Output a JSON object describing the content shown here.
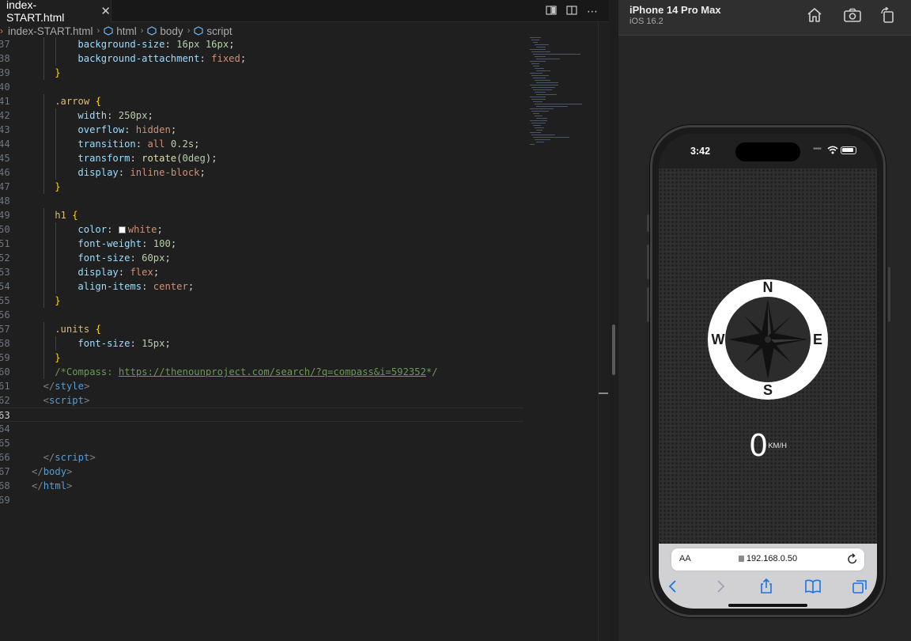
{
  "editor": {
    "tab_title": "index-START.html",
    "tab_close": "✕",
    "breadcrumb": {
      "file": "index-START.html",
      "html": "html",
      "body": "body",
      "script": "script"
    },
    "lines": [
      {
        "n": "37",
        "indent": 2,
        "t": [
          [
            "c-prop",
            "background-size"
          ],
          [
            "c-punc",
            ": "
          ],
          [
            "c-num",
            "16px 16px"
          ],
          [
            "c-punc",
            ";"
          ]
        ]
      },
      {
        "n": "38",
        "indent": 2,
        "t": [
          [
            "c-prop",
            "background-attachment"
          ],
          [
            "c-punc",
            ": "
          ],
          [
            "c-val",
            "fixed"
          ],
          [
            "c-punc",
            ";"
          ]
        ]
      },
      {
        "n": "39",
        "indent": 1,
        "t": [
          [
            "c-brace",
            "}"
          ]
        ]
      },
      {
        "n": "40",
        "indent": 0,
        "t": []
      },
      {
        "n": "41",
        "indent": 1,
        "t": [
          [
            "c-sel",
            ".arrow"
          ],
          [
            "c-punc",
            " "
          ],
          [
            "c-brace",
            "{"
          ]
        ]
      },
      {
        "n": "42",
        "indent": 2,
        "t": [
          [
            "c-prop",
            "width"
          ],
          [
            "c-punc",
            ": "
          ],
          [
            "c-num",
            "250px"
          ],
          [
            "c-punc",
            ";"
          ]
        ]
      },
      {
        "n": "43",
        "indent": 2,
        "t": [
          [
            "c-prop",
            "overflow"
          ],
          [
            "c-punc",
            ": "
          ],
          [
            "c-val",
            "hidden"
          ],
          [
            "c-punc",
            ";"
          ]
        ]
      },
      {
        "n": "44",
        "indent": 2,
        "t": [
          [
            "c-prop",
            "transition"
          ],
          [
            "c-punc",
            ": "
          ],
          [
            "c-val",
            "all "
          ],
          [
            "c-num",
            "0.2s"
          ],
          [
            "c-punc",
            ";"
          ]
        ]
      },
      {
        "n": "45",
        "indent": 2,
        "t": [
          [
            "c-prop",
            "transform"
          ],
          [
            "c-punc",
            ": "
          ],
          [
            "c-fn",
            "rotate"
          ],
          [
            "c-punc",
            "("
          ],
          [
            "c-num",
            "0deg"
          ],
          [
            "c-punc",
            ");"
          ]
        ]
      },
      {
        "n": "46",
        "indent": 2,
        "t": [
          [
            "c-prop",
            "display"
          ],
          [
            "c-punc",
            ": "
          ],
          [
            "c-val",
            "inline-block"
          ],
          [
            "c-punc",
            ";"
          ]
        ]
      },
      {
        "n": "47",
        "indent": 1,
        "t": [
          [
            "c-brace",
            "}"
          ]
        ]
      },
      {
        "n": "48",
        "indent": 0,
        "t": []
      },
      {
        "n": "49",
        "indent": 1,
        "t": [
          [
            "c-sel",
            "h1"
          ],
          [
            "c-punc",
            " "
          ],
          [
            "c-brace",
            "{"
          ]
        ]
      },
      {
        "n": "50",
        "indent": 2,
        "t": [
          [
            "c-prop",
            "color"
          ],
          [
            "c-punc",
            ": "
          ],
          [
            "swatch",
            ""
          ],
          [
            "c-val",
            "white"
          ],
          [
            "c-punc",
            ";"
          ]
        ]
      },
      {
        "n": "51",
        "indent": 2,
        "t": [
          [
            "c-prop",
            "font-weight"
          ],
          [
            "c-punc",
            ": "
          ],
          [
            "c-num",
            "100"
          ],
          [
            "c-punc",
            ";"
          ]
        ]
      },
      {
        "n": "52",
        "indent": 2,
        "t": [
          [
            "c-prop",
            "font-size"
          ],
          [
            "c-punc",
            ": "
          ],
          [
            "c-num",
            "60px"
          ],
          [
            "c-punc",
            ";"
          ]
        ]
      },
      {
        "n": "53",
        "indent": 2,
        "t": [
          [
            "c-prop",
            "display"
          ],
          [
            "c-punc",
            ": "
          ],
          [
            "c-val",
            "flex"
          ],
          [
            "c-punc",
            ";"
          ]
        ]
      },
      {
        "n": "54",
        "indent": 2,
        "t": [
          [
            "c-prop",
            "align-items"
          ],
          [
            "c-punc",
            ": "
          ],
          [
            "c-val",
            "center"
          ],
          [
            "c-punc",
            ";"
          ]
        ]
      },
      {
        "n": "55",
        "indent": 1,
        "t": [
          [
            "c-brace",
            "}"
          ]
        ]
      },
      {
        "n": "56",
        "indent": 0,
        "t": []
      },
      {
        "n": "57",
        "indent": 1,
        "t": [
          [
            "c-sel",
            ".units"
          ],
          [
            "c-punc",
            " "
          ],
          [
            "c-brace",
            "{"
          ]
        ]
      },
      {
        "n": "58",
        "indent": 2,
        "t": [
          [
            "c-prop",
            "font-size"
          ],
          [
            "c-punc",
            ": "
          ],
          [
            "c-num",
            "15px"
          ],
          [
            "c-punc",
            ";"
          ]
        ]
      },
      {
        "n": "59",
        "indent": 1,
        "t": [
          [
            "c-brace",
            "}"
          ]
        ]
      },
      {
        "n": "60",
        "indent": 1,
        "t": [
          [
            "c-comment",
            "/*Compass: "
          ],
          [
            "c-link",
            "https://thenounproject.com/search/?q=compass&i=592352"
          ],
          [
            "c-comment",
            "*/"
          ]
        ]
      },
      {
        "n": "61",
        "indent": 0.5,
        "t": [
          [
            "c-angle",
            "</"
          ],
          [
            "c-tag",
            "style"
          ],
          [
            "c-angle",
            ">"
          ]
        ]
      },
      {
        "n": "62",
        "indent": 0.5,
        "t": [
          [
            "c-angle",
            "<"
          ],
          [
            "c-tag",
            "script"
          ],
          [
            "c-angle",
            ">"
          ]
        ]
      },
      {
        "n": "63",
        "indent": 0,
        "t": [],
        "current": true
      },
      {
        "n": "64",
        "indent": 0,
        "t": []
      },
      {
        "n": "65",
        "indent": 0,
        "t": []
      },
      {
        "n": "66",
        "indent": 0.5,
        "t": [
          [
            "c-angle",
            "</"
          ],
          [
            "c-tag",
            "script"
          ],
          [
            "c-angle",
            ">"
          ]
        ]
      },
      {
        "n": "67",
        "indent": 0,
        "t": [
          [
            "c-angle",
            "</"
          ],
          [
            "c-tag",
            "body"
          ],
          [
            "c-angle",
            ">"
          ]
        ]
      },
      {
        "n": "68",
        "indent": 0,
        "t": [
          [
            "c-angle",
            "</"
          ],
          [
            "c-tag",
            "html"
          ],
          [
            "c-angle",
            ">"
          ]
        ]
      },
      {
        "n": "69",
        "indent": 0,
        "t": []
      }
    ]
  },
  "simulator": {
    "device_name": "iPhone 14 Pro Max",
    "os_version": "iOS 16.2",
    "icons": [
      "home-icon",
      "screenshot-icon",
      "rotate-icon"
    ]
  },
  "phone": {
    "time": "3:42",
    "compass": {
      "n": "N",
      "e": "E",
      "s": "S",
      "w": "W",
      "heading_deg": 0
    },
    "speed": {
      "value": "0",
      "unit": "KM/H"
    },
    "safari": {
      "aa": "AA",
      "url": "192.168.0.50"
    }
  },
  "colors": {
    "editor_bg": "#1f1f1f",
    "compass_ring": "#ffffff",
    "compass_rose": "#1b1b1b",
    "link": "#6a9955"
  }
}
